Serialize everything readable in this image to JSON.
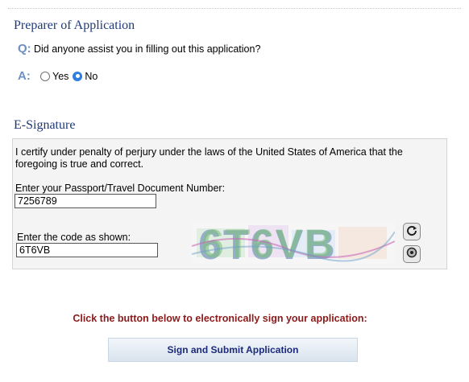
{
  "preparer": {
    "title": "Preparer of Application",
    "question_marker": "Q:",
    "question": "Did anyone assist you in filling out this application?",
    "answer_marker": "A:",
    "options": [
      "Yes",
      "No"
    ],
    "selected": "No"
  },
  "signature": {
    "title": "E-Signature",
    "certification": "I certify under penalty of perjury under the laws of the United States of America that the foregoing is true and correct.",
    "passport_label": "Enter your Passport/Travel Document Number:",
    "passport_value": "7256789",
    "code_label": "Enter the code as shown:",
    "code_value": "6T6VB",
    "captcha_text": "6T6VB",
    "refresh_icon": "refresh-icon",
    "audio_icon": "audio-icon"
  },
  "submit": {
    "instruction": "Click the button below to electronically sign your application:",
    "button_label": "Sign and Submit Application"
  },
  "colors": {
    "section_title": "#1f3a78",
    "qa_marker": "#6f8fc4",
    "instruction": "#8b1a1a",
    "button_text": "#1b2a7a"
  }
}
